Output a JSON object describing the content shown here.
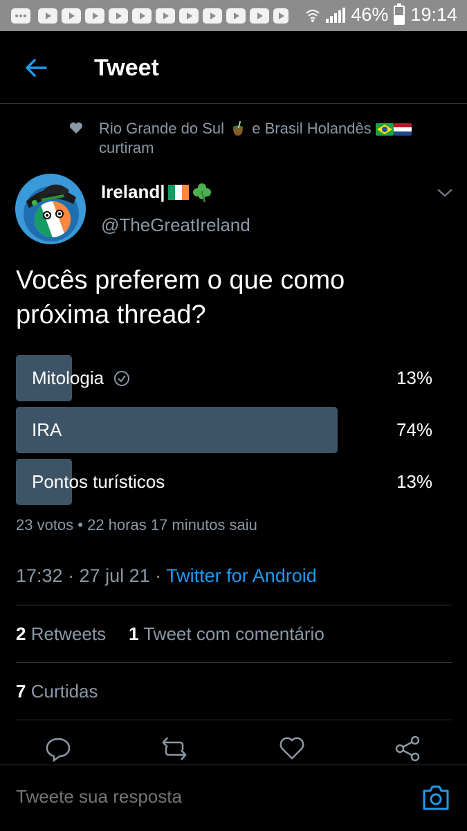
{
  "status_bar": {
    "battery": "46%",
    "time": "19:14"
  },
  "header": {
    "title": "Tweet"
  },
  "liked_by": {
    "part1": "Rio Grande do Sul",
    "part2": "e Brasil Holandês",
    "part3": "curtiram"
  },
  "author": {
    "name": "Ireland|",
    "handle": "@TheGreatIreland"
  },
  "tweet": {
    "text": "Vocês preferem o que como próxima thread?"
  },
  "poll": {
    "options": [
      {
        "label": "Mitologia",
        "percent": "13%",
        "value": 13,
        "selected": true
      },
      {
        "label": "IRA",
        "percent": "74%",
        "value": 74,
        "selected": false
      },
      {
        "label": "Pontos turísticos",
        "percent": "13%",
        "value": 13,
        "selected": false
      }
    ],
    "meta": "23 votos • 22 horas 17 minutos saiu"
  },
  "timestamp": {
    "time": "17:32 · 27 jul 21 · ",
    "source": "Twitter for Android"
  },
  "stats": {
    "retweets_count": "2",
    "retweets_label": "Retweets",
    "quotes_count": "1",
    "quotes_label": "Tweet com comentário",
    "likes_count": "7",
    "likes_label": "Curtidas"
  },
  "reply": {
    "placeholder": "Tweete sua resposta"
  },
  "colors": {
    "accent": "#1d9bf0",
    "poll_bar": "#3d5466",
    "muted": "#8b98a5",
    "background": "#000000"
  }
}
